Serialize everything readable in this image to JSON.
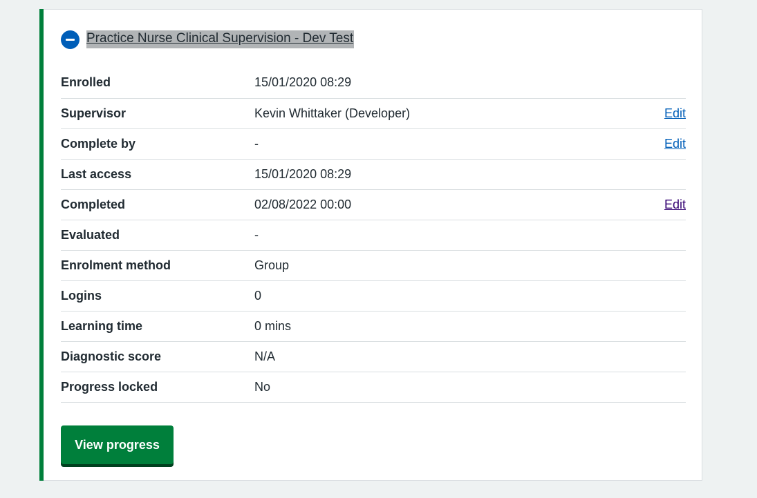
{
  "course": {
    "title": "Practice Nurse Clinical Supervision - Dev Test",
    "toggle_icon": "minus-circle-icon"
  },
  "details": [
    {
      "label": "Enrolled",
      "value": "15/01/2020 08:29",
      "action": ""
    },
    {
      "label": "Supervisor",
      "value": "Kevin Whittaker (Developer)",
      "action": "Edit"
    },
    {
      "label": "Complete by",
      "value": "-",
      "action": "Edit"
    },
    {
      "label": "Last access",
      "value": "15/01/2020 08:29",
      "action": ""
    },
    {
      "label": "Completed",
      "value": "02/08/2022 00:00",
      "action": "Edit"
    },
    {
      "label": "Evaluated",
      "value": "-",
      "action": ""
    },
    {
      "label": "Enrolment method",
      "value": "Group",
      "action": ""
    },
    {
      "label": "Logins",
      "value": "0",
      "action": ""
    },
    {
      "label": "Learning time",
      "value": "0 mins",
      "action": ""
    },
    {
      "label": "Diagnostic score",
      "value": "N/A",
      "action": ""
    },
    {
      "label": "Progress locked",
      "value": "No",
      "action": ""
    }
  ],
  "actions": {
    "view_progress_label": "View progress"
  },
  "colors": {
    "accent": "#007f3b",
    "link": "#005eb8",
    "visited_link": "#330072",
    "icon": "#005eb8"
  }
}
